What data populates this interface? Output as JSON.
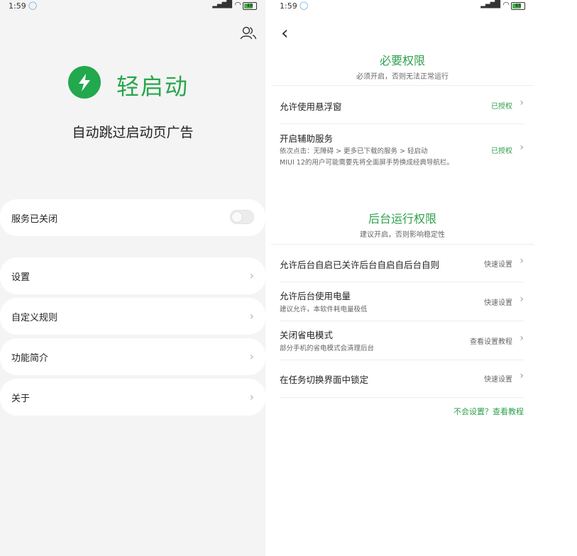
{
  "left": {
    "status_bar": {
      "time": "1:59",
      "battery": "48"
    },
    "app_name": "轻启动",
    "tagline": "自动跳过启动页广告",
    "service": {
      "label": "服务已关闭",
      "enabled": false
    },
    "menu": [
      {
        "label": "设置"
      },
      {
        "label": "自定义规则"
      },
      {
        "label": "功能简介"
      },
      {
        "label": "关于"
      }
    ],
    "icons": {
      "users": "users-icon",
      "logo": "lightning-icon",
      "chevron": "chevron-right-icon"
    },
    "colors": {
      "brand": "#28a64c",
      "background": "#f4f4f4"
    }
  },
  "right": {
    "status_bar": {
      "time": "1:59",
      "battery": "48"
    },
    "required": {
      "title": "必要权限",
      "subtitle": "必须开启，否则无法正常运行",
      "items": [
        {
          "title": "允许使用悬浮窗",
          "status": "已授权"
        },
        {
          "title": "开启辅助服务",
          "desc1": "依次点击：无障碍 > 更多已下载的服务 > 轻启动",
          "desc2": "MIUI 12的用户可能需要先将全面屏手势换成经典导航栏。",
          "status": "已授权"
        }
      ]
    },
    "background": {
      "title": "后台运行权限",
      "subtitle": "建议开启，否则影响稳定性",
      "items": [
        {
          "title": "允许后台自启已关许后台自启自后台自则",
          "status": "快速设置"
        },
        {
          "title": "允许后台使用电量",
          "desc1": "建议允许，本软件耗电量极低",
          "status": "快速设置"
        },
        {
          "title": "关闭省电模式",
          "desc1": "部分手机的省电模式会清理后台",
          "status": "查看设置教程"
        },
        {
          "title": "在任务切换界面中锁定",
          "status": "快速设置"
        }
      ]
    },
    "help_link": "不会设置？查看教程",
    "colors": {
      "accent": "#2ea04c"
    }
  }
}
